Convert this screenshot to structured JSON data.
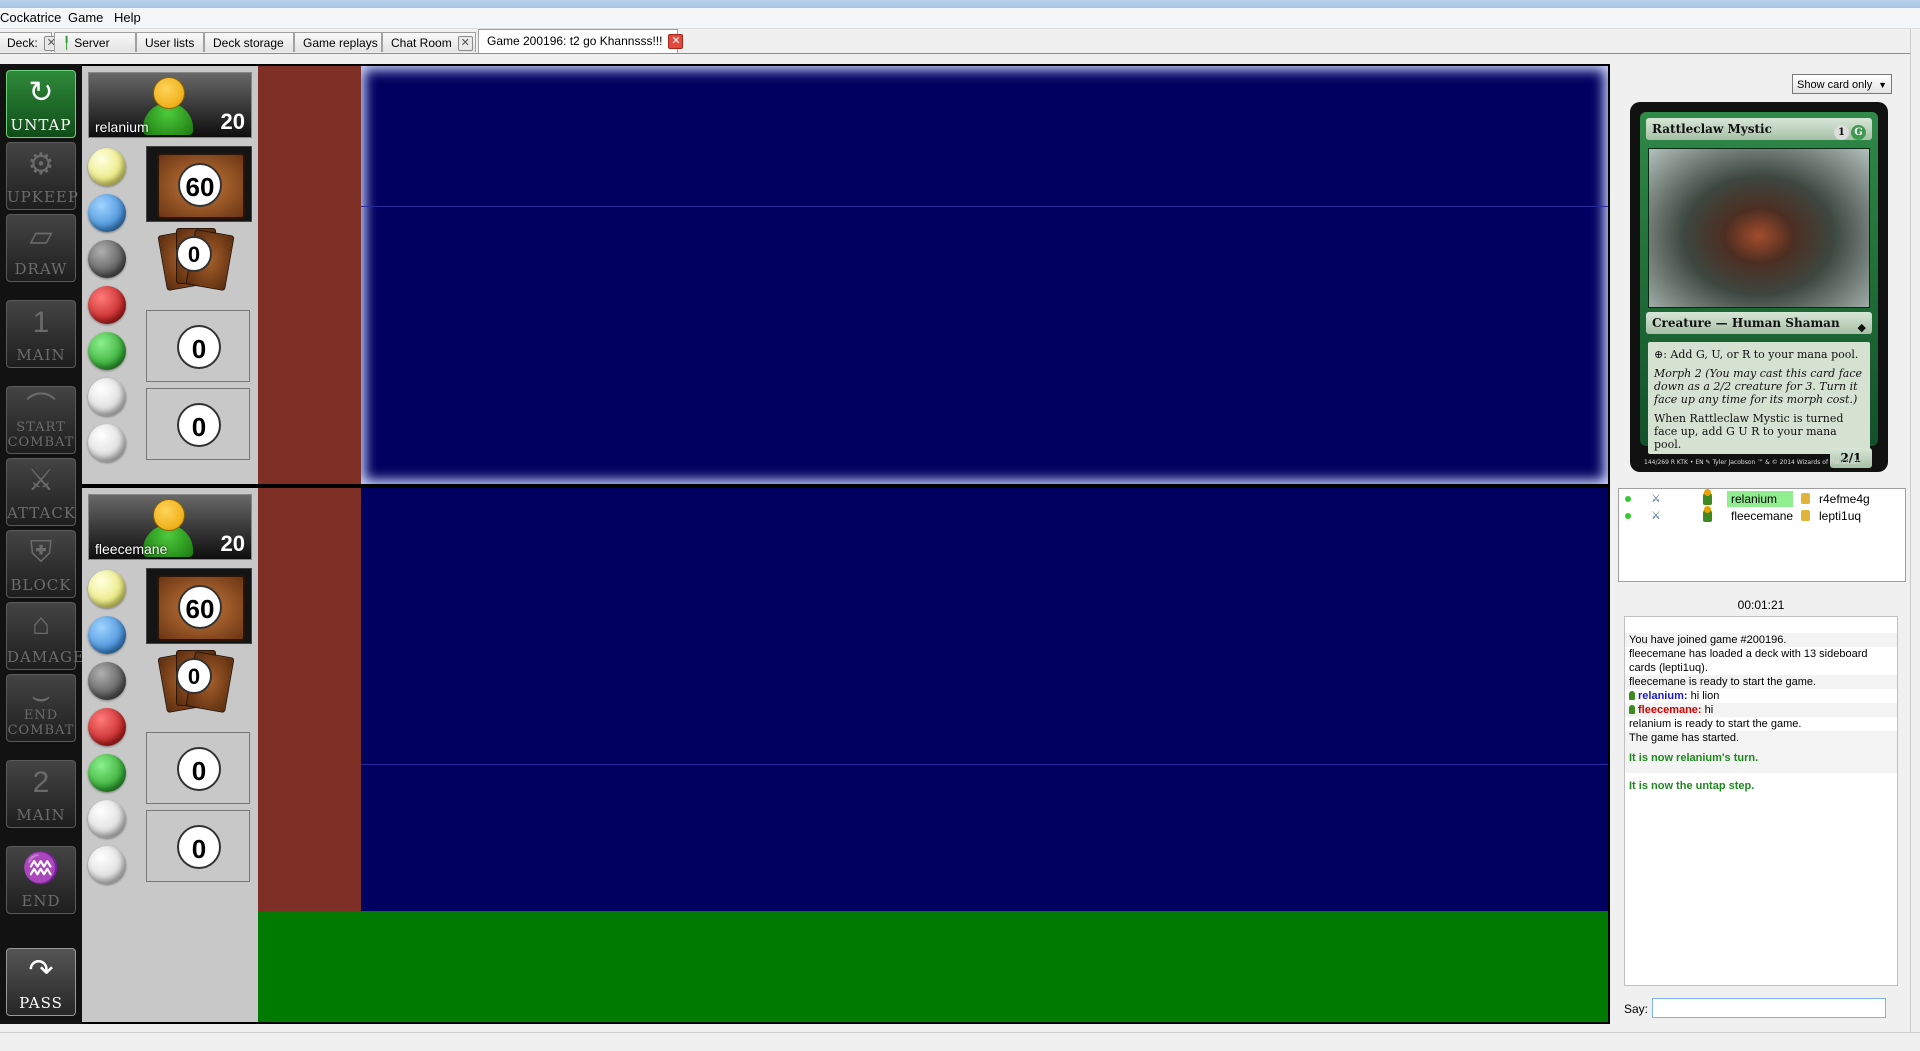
{
  "menu": [
    "Cockatrice",
    "Game",
    "Help"
  ],
  "tabs": [
    {
      "label": "Deck:",
      "closable": true
    },
    {
      "label": "Server",
      "closable": false
    },
    {
      "label": "User lists",
      "closable": false
    },
    {
      "label": "Deck storage",
      "closable": false
    },
    {
      "label": "Game replays",
      "closable": false
    },
    {
      "label": "Chat Room",
      "closable": true
    },
    {
      "label": "Game 200196: t2 go Khannsss!!!",
      "closable": true,
      "active": true
    }
  ],
  "phases": [
    {
      "label": "Untap",
      "icon": "untap-arrow-icon",
      "active": true
    },
    {
      "label": "Upkeep",
      "icon": "gear-icon",
      "active": false
    },
    {
      "label": "Draw",
      "icon": "card-draw-icon",
      "active": false
    },
    {
      "label": "Main",
      "icon": "main-1-icon",
      "glyph": "1",
      "active": false
    },
    {
      "label": "Start Combat",
      "icon": "start-combat-icon",
      "active": false
    },
    {
      "label": "Attack",
      "icon": "sword-icon",
      "active": false
    },
    {
      "label": "Block",
      "icon": "shield-icon",
      "active": false
    },
    {
      "label": "Damage",
      "icon": "tombstone-icon",
      "active": false
    },
    {
      "label": "End Combat",
      "icon": "end-combat-icon",
      "active": false
    },
    {
      "label": "Main",
      "icon": "main-2-icon",
      "glyph": "2",
      "active": false
    },
    {
      "label": "End",
      "icon": "broom-icon",
      "active": false
    },
    {
      "label": "Pass",
      "icon": "pass-arrow-icon",
      "active": false
    }
  ],
  "players": [
    {
      "name": "relanium",
      "life": "20",
      "library": "60",
      "hand": "0",
      "graveyard": "0",
      "exile": "0"
    },
    {
      "name": "fleecemane",
      "life": "20",
      "library": "60",
      "hand": "0",
      "graveyard": "0",
      "exile": "0"
    }
  ],
  "view_select": "Show card only",
  "card": {
    "name": "Rattleclaw Mystic",
    "cost": [
      "1",
      "G"
    ],
    "type": "Creature — Human Shaman",
    "text": [
      "⊕: Add G, U, or R to your mana pool.",
      "Morph 2 (You may cast this card face down as a 2/2 creature for 3. Turn it face up any time for its morph cost.)",
      "When Rattleclaw Mystic is turned face up, add G U R to your mana pool."
    ],
    "pt": "2/1",
    "footer": "144/269 R KTK • EN ✎ Tyler Jacobson ™ & © 2014 Wizards of the Coast",
    "frame_color": "#2f8a47"
  },
  "player_list": [
    {
      "name": "relanium",
      "deck": "r4efme4g",
      "highlight": true
    },
    {
      "name": "fleecemane",
      "deck": "lepti1uq",
      "highlight": false
    }
  ],
  "clock": "00:01:21",
  "chat": [
    {
      "text": "You have joined game #200196.",
      "style": "plain"
    },
    {
      "text": "fleecemane has loaded a deck with 13 sideboard cards (lepti1uq).",
      "style": "plain"
    },
    {
      "text": "fleecemane is ready to start the game.",
      "style": "plain"
    },
    {
      "sender": "relanium:",
      "text": " hi lion",
      "style": "blue"
    },
    {
      "sender": "fleecemane:",
      "text": " hi",
      "style": "red"
    },
    {
      "text": "relanium is ready to start the game.",
      "style": "plain"
    },
    {
      "text": "The game has started.",
      "style": "plain"
    },
    {
      "text": "It is now relanium's turn.",
      "style": "green"
    },
    {
      "text": "It is now the untap step.",
      "style": "green"
    }
  ],
  "say_label": "Say:",
  "colors": {
    "table": "#000060",
    "stack": "#7e3026",
    "hand": "#007a00",
    "active_phase": "#2f8a3a"
  }
}
